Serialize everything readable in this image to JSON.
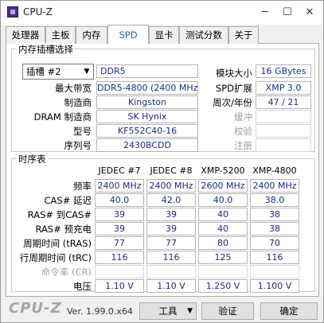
{
  "window": {
    "title": "CPU-Z",
    "min": "─",
    "max": "☐",
    "close": "✕"
  },
  "tabs": [
    {
      "label": "处理器"
    },
    {
      "label": "主板"
    },
    {
      "label": "内存"
    },
    {
      "label": "SPD"
    },
    {
      "label": "显卡"
    },
    {
      "label": "测试分数"
    },
    {
      "label": "关于"
    }
  ],
  "slot_group": {
    "legend": "内存插槽选择",
    "slot_select": "插槽 #2",
    "type_value": "DDR5",
    "labels": {
      "max_bandwidth": "最大带宽",
      "manufacturer": "制造商",
      "dram_manufacturer": "DRAM 制造商",
      "model": "型号",
      "serial": "序列号",
      "module_size": "模块大小",
      "spd_ext": "SPD扩展",
      "week_year": "周次/年份",
      "buffered": "缓冲",
      "correction": "校验",
      "registered": "注册"
    },
    "values": {
      "max_bandwidth": "DDR5-4800 (2400 MHz)",
      "manufacturer": "Kingston",
      "dram_manufacturer": "SK Hynix",
      "model": "KF552C40-16",
      "serial": "2430BCDD",
      "module_size": "16 GBytes",
      "spd_ext": "XMP 3.0",
      "week_year": "47 / 21",
      "buffered": "",
      "correction": "",
      "registered": ""
    }
  },
  "timing_group": {
    "legend": "时序表",
    "columns": [
      "JEDEC #7",
      "JEDEC #8",
      "XMP-5200",
      "XMP-4800"
    ],
    "rows": [
      {
        "label": "频率",
        "values": [
          "2400 MHz",
          "2400 MHz",
          "2600 MHz",
          "2400 MHz"
        ]
      },
      {
        "label": "CAS# 延迟",
        "values": [
          "40.0",
          "42.0",
          "40.0",
          "38.0"
        ]
      },
      {
        "label": "RAS# 到CAS#",
        "values": [
          "39",
          "39",
          "40",
          "38"
        ]
      },
      {
        "label": "RAS# 预充电",
        "values": [
          "39",
          "39",
          "40",
          "38"
        ]
      },
      {
        "label": "周期时间 (tRAS)",
        "values": [
          "77",
          "77",
          "80",
          "70"
        ]
      },
      {
        "label": "行周期时间 (tRC)",
        "values": [
          "116",
          "116",
          "125",
          "116"
        ]
      },
      {
        "label": "命令率 (CR)",
        "values": [
          "",
          "",
          "",
          ""
        ],
        "disabled": true
      },
      {
        "label": "电压",
        "values": [
          "1.10 V",
          "1.10 V",
          "1.250 V",
          "1.100 V"
        ]
      }
    ]
  },
  "footer": {
    "logo": "CPU-Z",
    "version": "Ver. 1.99.0.x64",
    "tools_label": "工具",
    "validate_label": "验证",
    "ok_label": "确定"
  }
}
